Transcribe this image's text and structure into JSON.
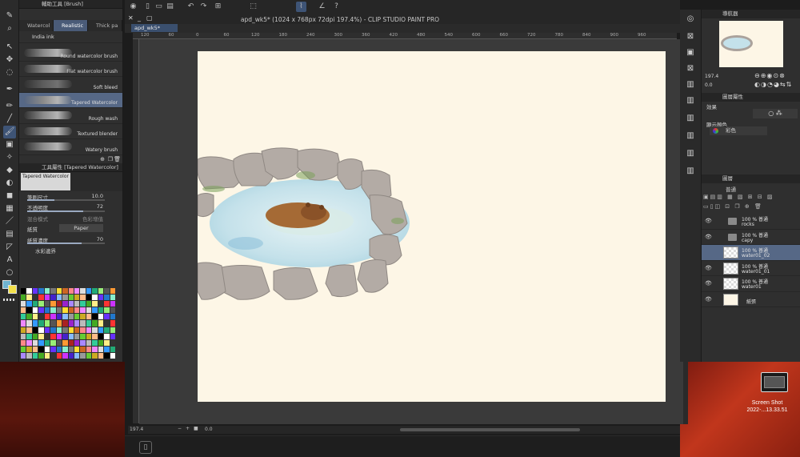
{
  "window": {
    "title": "apd_wk5* (1024 x 768px 72dpi 197.4%)  - CLIP STUDIO PAINT PRO",
    "doc_tab": "apd_wk5*"
  },
  "left_panel": {
    "title": "輔助工具 [Brush]",
    "tabs": [
      "Watercol",
      "Realistic",
      "Thick pa"
    ],
    "group": "India ink",
    "brushes": [
      "Round watercolor brush",
      "Flat watercolor brush",
      "Soft bleed",
      "Tapered Watercolor",
      "Rough wash",
      "Textured blender",
      "Watery brush"
    ],
    "selected_brush": "Tapered Watercolor"
  },
  "tool_property": {
    "title": "工具屬性 [Tapered Watercolor]",
    "preview_label": "Tapered Watercolor",
    "brush_size_label": "筆刷尺寸",
    "brush_size_value": "10.0",
    "brush_size_fraction": 0.35,
    "opacity_label": "不透明度",
    "opacity_value": "72",
    "opacity_fraction": 0.72,
    "blend_label": "混合模式",
    "blend_value": "色彩增值",
    "paper_label": "紙質",
    "paper_value": "Paper",
    "paper_density_label": "紙質濃度",
    "paper_density_value": "70",
    "paper_density_fraction": 0.7,
    "watercolor_edge_label": "水彩邊界"
  },
  "ruler": {
    "ticks": [
      "120",
      "60",
      "0",
      "60",
      "120",
      "180",
      "240",
      "300",
      "360",
      "420",
      "480",
      "540",
      "600",
      "660",
      "720",
      "780",
      "840",
      "900",
      "960"
    ]
  },
  "status": {
    "zoom": "197.4",
    "rotation": "0.0"
  },
  "navigator": {
    "title": "導航器",
    "zoom": "197.4",
    "rotation": "0.0"
  },
  "layer_property": {
    "title": "圖層屬性",
    "effect_label": "效果",
    "display_color_label": "顯示顏色",
    "display_color_value": "彩色"
  },
  "layers": {
    "title": "圖層",
    "blend_mode": "普通",
    "items": [
      {
        "opacity": "100 %",
        "mode": "普通",
        "name": "rocks",
        "type": "folder",
        "selected": false
      },
      {
        "opacity": "100 %",
        "mode": "普通",
        "name": "capy",
        "type": "folder",
        "selected": false
      },
      {
        "opacity": "100 %",
        "mode": "普通",
        "name": "water01_02",
        "type": "raster",
        "selected": true
      },
      {
        "opacity": "100 %",
        "mode": "普通",
        "name": "water01_01",
        "type": "raster",
        "selected": false
      },
      {
        "opacity": "100 %",
        "mode": "普通",
        "name": "water01",
        "type": "raster",
        "selected": false
      },
      {
        "opacity": "",
        "mode": "",
        "name": "紙張",
        "type": "paper",
        "selected": false
      }
    ]
  },
  "desktop": {
    "file_label_1": "Screen Shot",
    "file_label_2": "2022-...13.33.51"
  },
  "colors": {
    "accent": "#4a5b78",
    "selected_row": "#566886",
    "paper": "#fdf6e6",
    "foreground_color": "#6fb3d0",
    "background_color": "#f2e04a"
  }
}
